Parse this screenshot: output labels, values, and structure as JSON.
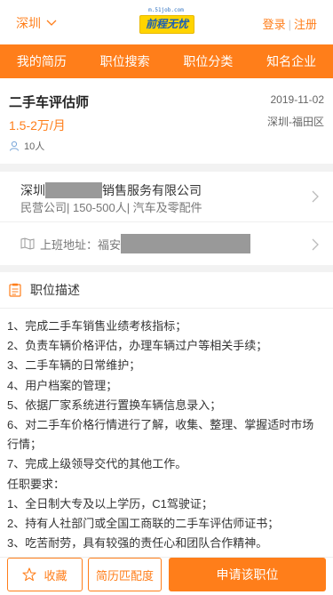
{
  "header": {
    "city": "深圳",
    "logo_url": "m.51job.com",
    "logo_text": "前程无忧",
    "login": "登录",
    "separator": "|",
    "register": "注册"
  },
  "nav": [
    "我的简历",
    "职位搜索",
    "职位分类",
    "知名企业"
  ],
  "job": {
    "title": "二手车评估师",
    "date": "2019-11-02",
    "salary": "1.5-2万/月",
    "location": "深圳-福田区",
    "headcount": "10人"
  },
  "company": {
    "name_prefix": "深圳",
    "name_suffix": "销售服务有限公司",
    "meta": "民营公司| 150-500人| 汽车及零配件"
  },
  "address": {
    "label": "上班地址：福安"
  },
  "description": {
    "heading": "职位描述",
    "lines": [
      "1、完成二手车销售业绩考核指标；",
      "2、负责车辆价格评估，办理车辆过户等相关手续；",
      "3、二手车辆的日常维护；",
      "4、用户档案的管理；",
      "5、依据厂家系统进行置换车辆信息录入；",
      "6、对二手车价格行情进行了解，收集、整理、掌握适时市场行情；",
      "7、完成上级领导交代的其他工作。",
      "任职要求：",
      "1、全日制大专及以上学历，C1驾驶证；",
      "2、持有人社部门或全国工商联的二手车评估师证书；",
      "3、吃苦耐劳，具有较强的责任心和团队合作精神。"
    ]
  },
  "actions": {
    "favorite": "收藏",
    "match": "简历匹配度",
    "apply": "申请该职位"
  },
  "colors": {
    "accent": "#ff7e1a",
    "logo_bg": "#ffd400"
  }
}
